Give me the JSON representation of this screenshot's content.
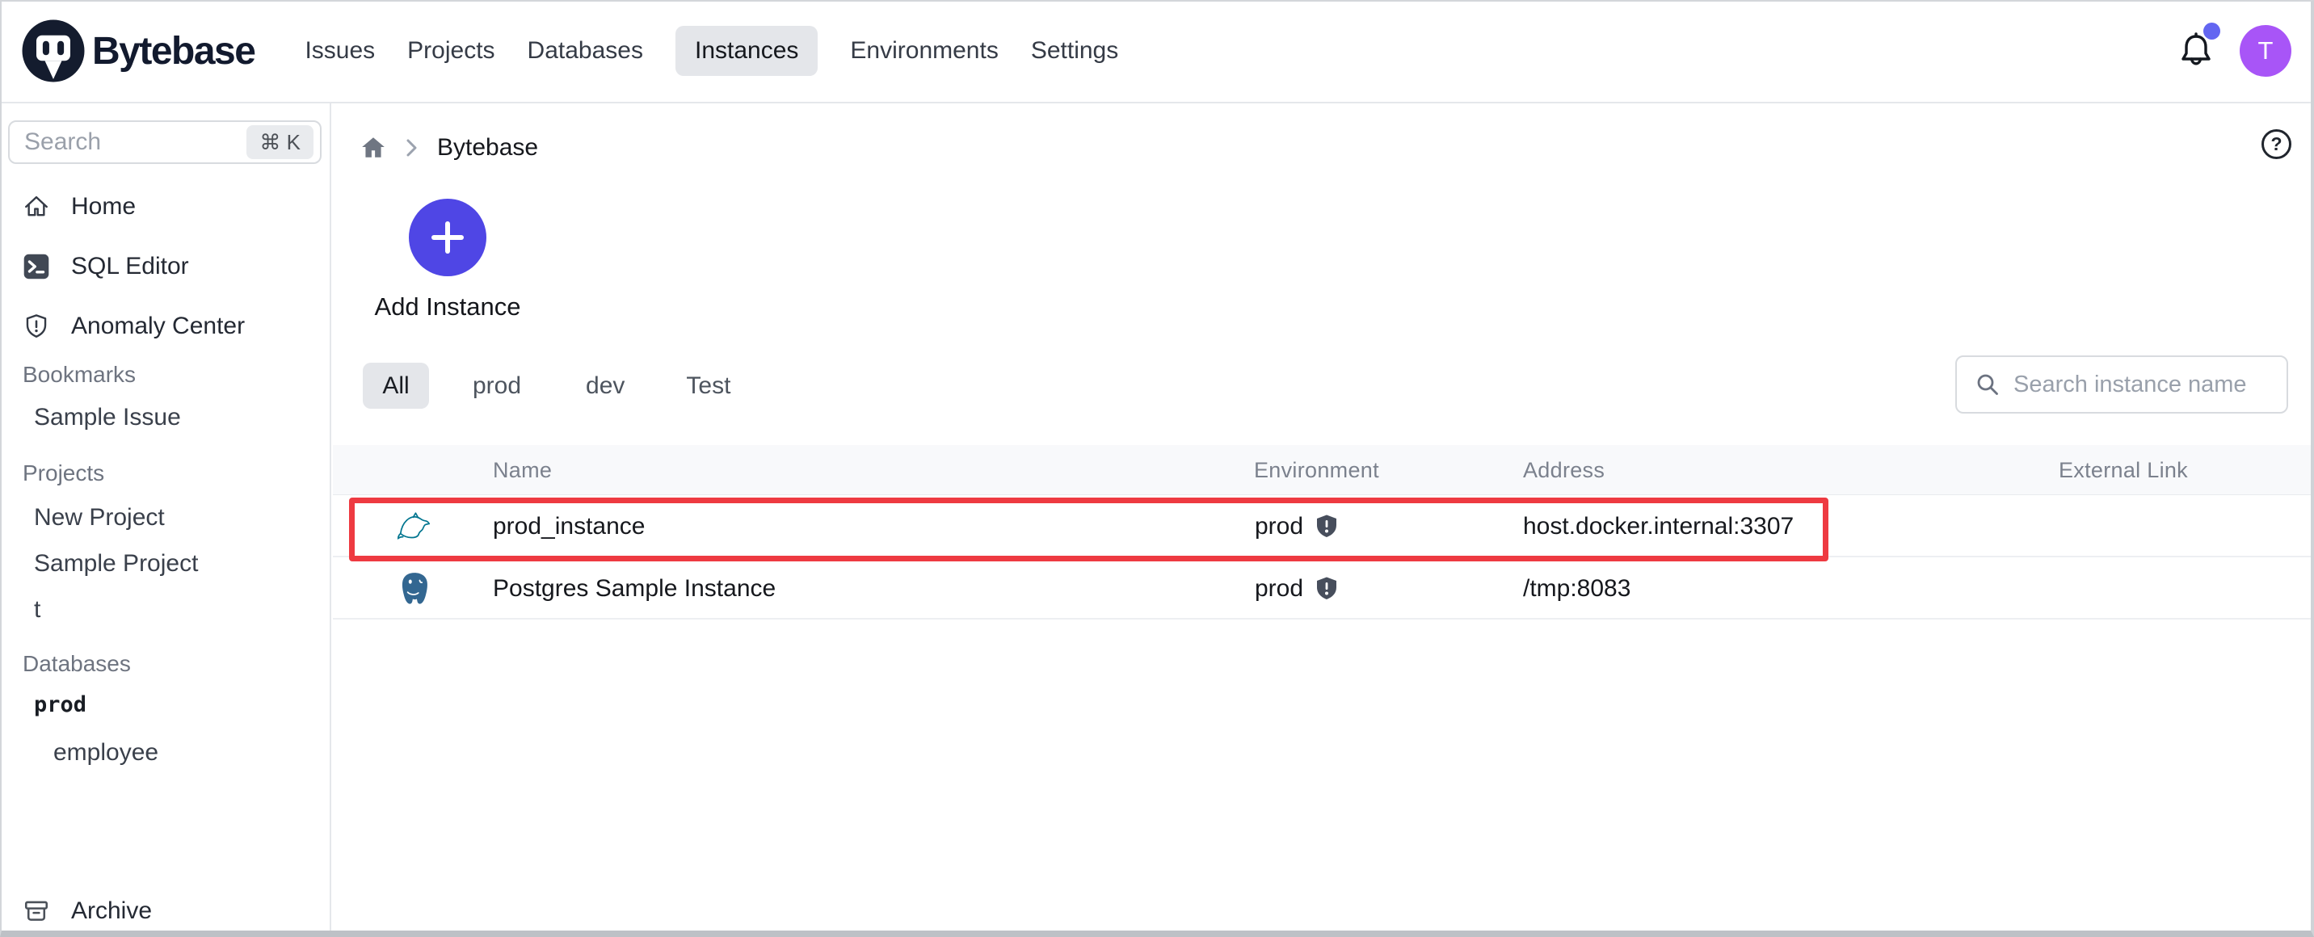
{
  "navbar": {
    "brand": "Bytebase",
    "items": [
      "Issues",
      "Projects",
      "Databases",
      "Instances",
      "Environments",
      "Settings"
    ],
    "active_item": "Instances",
    "avatar_initial": "T"
  },
  "sidebar": {
    "search": {
      "placeholder": "Search",
      "shortcut": "⌘ K"
    },
    "nav": [
      {
        "label": "Home",
        "icon": "home-icon"
      },
      {
        "label": "SQL Editor",
        "icon": "sql-editor-icon"
      },
      {
        "label": "Anomaly Center",
        "icon": "anomaly-shield-icon"
      }
    ],
    "sections": [
      {
        "title": "Bookmarks",
        "items": [
          "Sample Issue"
        ]
      },
      {
        "title": "Projects",
        "items": [
          "New Project",
          "Sample Project",
          "t"
        ]
      },
      {
        "title": "Databases",
        "items": [
          "prod",
          "employee"
        ]
      }
    ],
    "archive_label": "Archive"
  },
  "content": {
    "breadcrumb": {
      "current": "Bytebase"
    },
    "help_glyph": "?",
    "add_instance_label": "Add Instance",
    "tabs": [
      "All",
      "prod",
      "dev",
      "Test"
    ],
    "active_tab": "All",
    "search_placeholder": "Search instance name",
    "table": {
      "columns": [
        "Name",
        "Environment",
        "Address",
        "External Link"
      ],
      "rows": [
        {
          "engine": "mysql",
          "name": "prod_instance",
          "environment": "prod",
          "address": "host.docker.internal:3307",
          "external_link": "",
          "highlighted": true
        },
        {
          "engine": "postgres",
          "name": "Postgres Sample Instance",
          "environment": "prod",
          "address": "/tmp:8083",
          "external_link": "",
          "highlighted": false
        }
      ]
    }
  },
  "colors": {
    "accent_indigo": "#4f46e5",
    "avatar_purple": "#a855f7",
    "notification_dot": "#6366f1",
    "highlight_red": "#ee3a41",
    "mysql_teal": "#00758f",
    "postgres_blue": "#336791",
    "active_chip_gray": "#e4e6ea"
  }
}
